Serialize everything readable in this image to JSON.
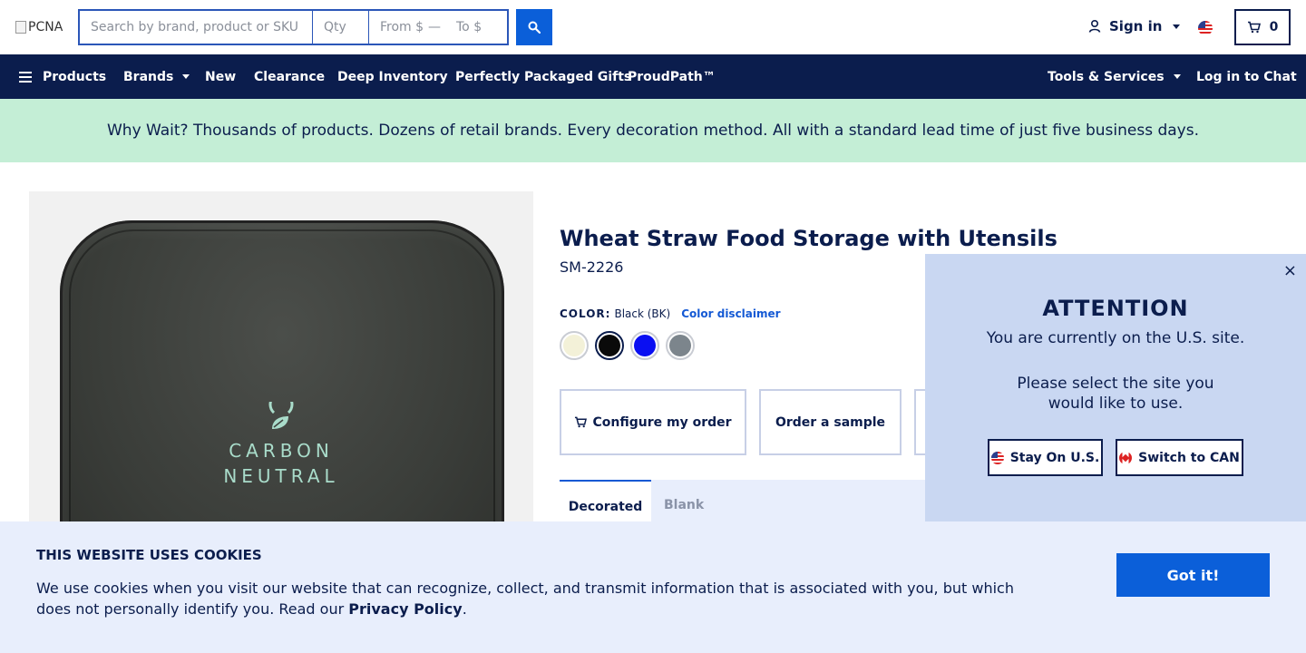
{
  "header": {
    "logo_alt": "PCNA",
    "search": {
      "placeholder": "Search by brand, product or SKU"
    },
    "qty": {
      "placeholder": "Qty"
    },
    "price_from": {
      "placeholder": "From $"
    },
    "price_to": {
      "placeholder": "To $"
    },
    "price_separator": "—",
    "sign_in": "Sign in",
    "cart_count": "0"
  },
  "nav": {
    "products": "Products",
    "brands": "Brands",
    "new": "New",
    "clearance": "Clearance",
    "deep_inventory": "Deep Inventory",
    "gifts": "Perfectly Packaged Gifts",
    "proudpath": "ProudPath™",
    "tools": "Tools & Services",
    "chat": "Log in to Chat"
  },
  "promo": {
    "text": "Why Wait? Thousands of products. Dozens of retail brands. Every decoration method. All with a standard lead time of just five business days."
  },
  "product": {
    "image_text_line1": "CARBON",
    "image_text_line2": "NEUTRAL",
    "title": "Wheat Straw Food Storage with Utensils",
    "sku": "SM-2226",
    "color_label": "COLOR:",
    "color_value": "Black (BK)",
    "color_disclaimer": "Color disclaimer",
    "swatches": [
      {
        "name": "Cream",
        "color": "#f3f1d8"
      },
      {
        "name": "Black",
        "color": "#0a0a0a"
      },
      {
        "name": "Blue",
        "color": "#0a0ff2"
      },
      {
        "name": "Gray",
        "color": "#7c858c"
      }
    ],
    "configure_label": "Configure my order",
    "sample_label": "Order a sample",
    "tabs": {
      "decorated": "Decorated",
      "blank": "Blank"
    }
  },
  "attention": {
    "close": "×",
    "title": "ATTENTION",
    "message1": "You are currently on the U.S. site.",
    "message2": "Please select the site you would like to use.",
    "stay_label": "Stay On U.S.",
    "switch_label": "Switch to CAN"
  },
  "cookie": {
    "title": "THIS WEBSITE USES COOKIES",
    "text": "We use cookies when you visit our website that can recognize, collect, and transmit information that is associated with you, but which does not personally identify you. Read our",
    "policy_link": "Privacy Policy",
    "period": ".",
    "button": "Got it!"
  },
  "colors": {
    "navy": "#0b1d4d",
    "accent_blue": "#0b5fd9",
    "promo_green": "#c4eed6",
    "popup_bg": "#c9d7f2",
    "cookie_bg": "#e8eefc"
  }
}
